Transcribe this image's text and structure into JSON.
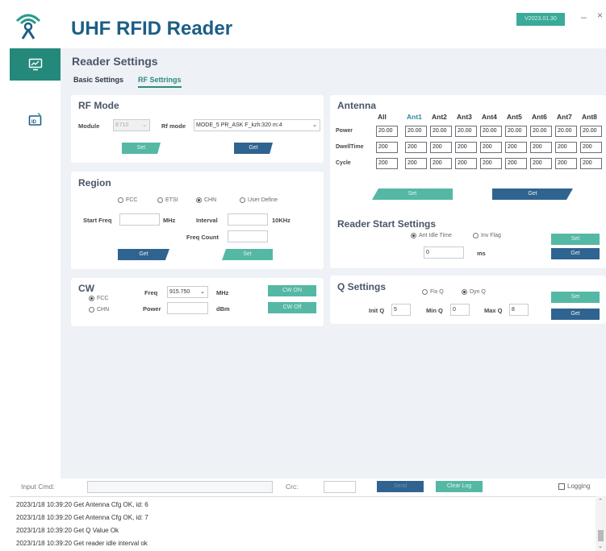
{
  "app": {
    "title": "UHF RFID Reader",
    "version": "V2023.01.30",
    "min_icon": "–",
    "close_icon": "×"
  },
  "sidebar": {
    "items": [
      {
        "name": "reader-settings",
        "icon": "monitor-icon"
      },
      {
        "name": "system-settings",
        "icon": "device-icon"
      }
    ]
  },
  "page": {
    "title": "Reader Settings",
    "tabs": [
      "Basic Settings",
      "RF Settrings"
    ]
  },
  "rf_mode": {
    "title": "RF Mode",
    "module_label": "Module",
    "module_value": "E710",
    "rfmode_label": "Rf mode",
    "rfmode_value": "MODE_5   PR_ASK F_kzh:320 m:4",
    "set": "Set",
    "get": "Get"
  },
  "region": {
    "title": "Region",
    "options": [
      "FCC",
      "ETSI",
      "CHN",
      "User Define"
    ],
    "selected": "CHN",
    "start_freq_label": "Start Freq",
    "start_freq_unit": "MHz",
    "interval_label": "Interval",
    "interval_unit": "10KHz",
    "freq_count_label": "Freq Count",
    "get": "Get",
    "set": "Set"
  },
  "cw": {
    "title": "CW",
    "options": [
      "FCC",
      "CHN"
    ],
    "selected": "FCC",
    "freq_label": "Freq",
    "freq_value": "915.750",
    "freq_unit": "MHz",
    "power_label": "Power",
    "power_unit": "dBm",
    "on": "CW ON",
    "off": "CW Off"
  },
  "antenna": {
    "title": "Antenna",
    "columns": [
      "All",
      "Ant1",
      "Ant2",
      "Ant3",
      "Ant4",
      "Ant5",
      "Ant6",
      "Ant7",
      "Ant8"
    ],
    "rows": [
      {
        "label": "Power",
        "values": [
          "20.00",
          "20.00",
          "20.00",
          "20.00",
          "20.00",
          "20.00",
          "20.00",
          "20.00",
          "20.00"
        ]
      },
      {
        "label": "DwellTime",
        "values": [
          "200",
          "200",
          "200",
          "200",
          "200",
          "200",
          "200",
          "200",
          "200"
        ]
      },
      {
        "label": "Cycle",
        "values": [
          "200",
          "200",
          "200",
          "200",
          "200",
          "200",
          "200",
          "200",
          "200"
        ]
      }
    ],
    "set": "Set",
    "get": "Get"
  },
  "start_settings": {
    "title": "Reader Start Settings",
    "options": [
      "Ant Idle Time",
      "Inv Flag"
    ],
    "selected": "Ant Idle Time",
    "value": "0",
    "unit": "ms",
    "set": "Set",
    "get": "Get"
  },
  "q_settings": {
    "title": "Q Settings",
    "options": [
      "Fix Q",
      "Dyn Q"
    ],
    "selected": "Dyn Q",
    "init_label": "Init Q",
    "init_value": "5",
    "min_label": "Min Q",
    "min_value": "0",
    "max_label": "Max Q",
    "max_value": "8",
    "set": "Set",
    "get": "Get"
  },
  "cmd": {
    "input_label": "Input Cmd:",
    "crc_label": "Crc:",
    "send": "Send",
    "clear": "Clear Log",
    "logging": "Logging"
  },
  "log": [
    "2023/1/18 10:39:20 Get Antenna Cfg OK, id: 6",
    "2023/1/18 10:39:20 Get Antenna Cfg OK, id: 7",
    "2023/1/18 10:39:20 Get Q Value Ok",
    "2023/1/18 10:39:20 Get reader idle interval ok"
  ],
  "colors": {
    "accent": "#24897b",
    "title": "#1c5e86",
    "navy_button": "#2f6390",
    "teal_button": "#54b8a4",
    "panel_bg": "#eef1f6"
  }
}
